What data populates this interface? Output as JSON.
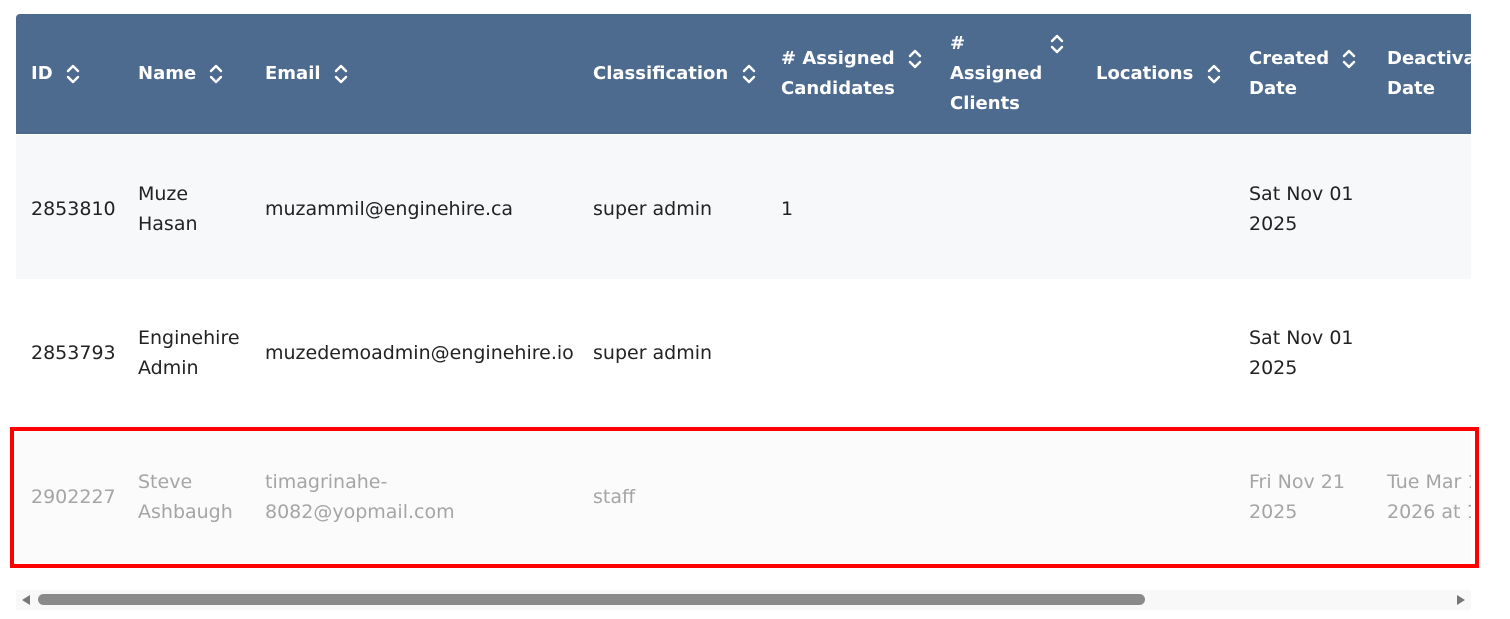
{
  "table": {
    "columns": [
      {
        "label": "ID"
      },
      {
        "label": "Name"
      },
      {
        "label": "Email"
      },
      {
        "label": "Classification"
      },
      {
        "label_line1": "# Assigned",
        "label_line2": "Candidates"
      },
      {
        "label_line1": "#",
        "label_line2": "Assigned",
        "label_line3": "Clients"
      },
      {
        "label": "Locations"
      },
      {
        "label_line1": "Created",
        "label_line2": "Date"
      },
      {
        "label_line1": "Deactiva",
        "label_line2": "Date"
      }
    ],
    "rows": [
      {
        "id": "2853810",
        "name_line1": "Muze",
        "name_line2": "Hasan",
        "email": "muzammil@enginehire.ca",
        "classification": "super admin",
        "assigned_candidates": "1",
        "created_line1": "Sat Nov 01",
        "created_line2": "2025"
      },
      {
        "id": "2853793",
        "name_line1": "Enginehire",
        "name_line2": "Admin",
        "email": "muzedemoadmin@enginehire.io",
        "classification": "super admin",
        "created_line1": "Sat Nov 01",
        "created_line2": "2025"
      },
      {
        "id": "2902227",
        "name_line1": "Steve",
        "name_line2": "Ashbaugh",
        "email_line1": "timagrinahe-",
        "email_line2": "8082@yopmail.com",
        "classification": "staff",
        "created_line1": "Fri Nov 21",
        "created_line2": "2025",
        "deactivated_line1": "Tue Mar 1",
        "deactivated_line2": "2026 at 1"
      }
    ]
  },
  "colors": {
    "header_bg": "#4d6a8f",
    "highlight_border": "#ff0000",
    "inactive_text": "#a5a5a5"
  },
  "icons": {
    "sort": "sort-chevrons-icon",
    "scroll_left": "scroll-left-arrow-icon",
    "scroll_right": "scroll-right-arrow-icon"
  }
}
